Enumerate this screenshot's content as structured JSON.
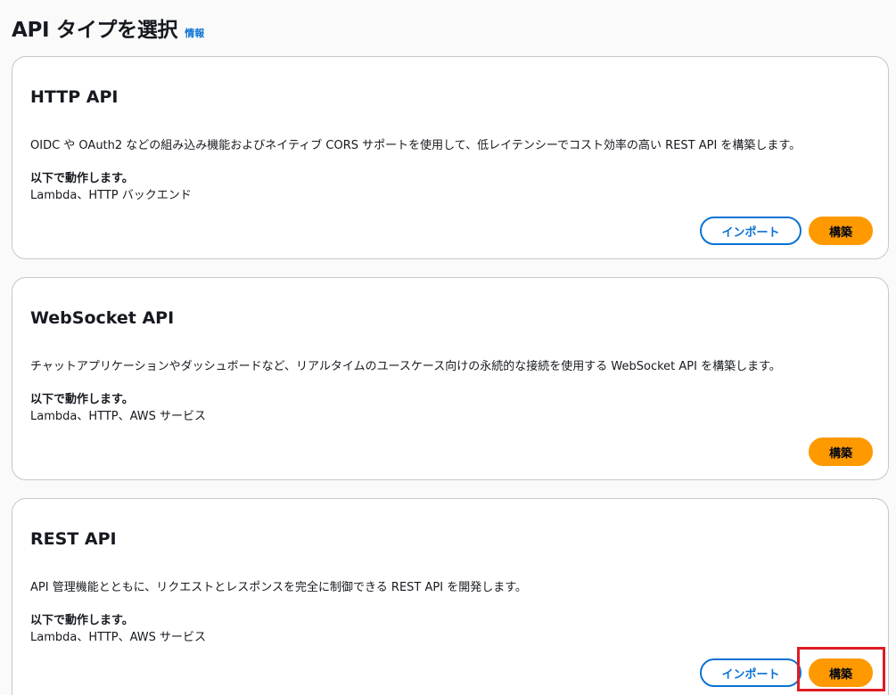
{
  "header": {
    "title": "API タイプを選択",
    "info_label": "情報"
  },
  "cards": [
    {
      "title": "HTTP API",
      "description": "OIDC や OAuth2 などの組み込み機能およびネイティブ CORS サポートを使用して、低レイテンシーでコスト効率の高い REST API を構築します。",
      "works_with_label": "以下で動作します。",
      "works_with_value": "Lambda、HTTP バックエンド",
      "import_label": "インポート",
      "build_label": "構築"
    },
    {
      "title": "WebSocket API",
      "description": "チャットアプリケーションやダッシュボードなど、リアルタイムのユースケース向けの永続的な接続を使用する WebSocket API を構築します。",
      "works_with_label": "以下で動作します。",
      "works_with_value": "Lambda、HTTP、AWS サービス",
      "build_label": "構築"
    },
    {
      "title": "REST API",
      "description": "API 管理機能とともに、リクエストとレスポンスを完全に制御できる REST API を開発します。",
      "works_with_label": "以下で動作します。",
      "works_with_value": "Lambda、HTTP、AWS サービス",
      "import_label": "インポート",
      "build_label": "構築"
    }
  ],
  "colors": {
    "primary_button": "#ff9900",
    "link": "#0972d3",
    "highlight": "#e01b24"
  }
}
